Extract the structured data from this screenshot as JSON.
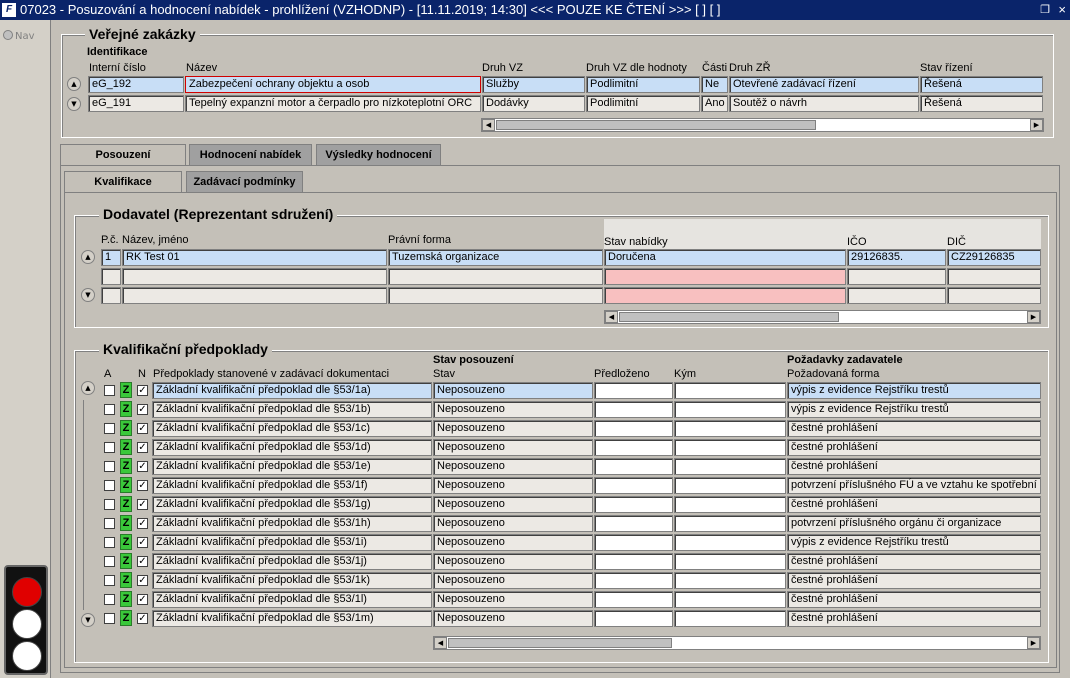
{
  "window": {
    "title": "07023 - Posuzování a hodnocení nabídek - prohlížení (VZHODNP) - [11.11.2019; 14:30] <<< POUZE KE ČTENÍ >>>  [ ]  [ ]",
    "icon": "app-logo-icon"
  },
  "nav": {
    "label": "Nav"
  },
  "zakazky": {
    "title": "Veřejné zakázky",
    "section": "Identifikace",
    "headers": {
      "interni": "Interní číslo",
      "nazev": "Název",
      "druh": "Druh VZ",
      "druh_hodnota": "Druh VZ dle hodnoty",
      "casti": "Části",
      "druh_zr": "Druh ZŘ",
      "stav": "Stav řízení"
    },
    "rows": [
      {
        "interni": "eG_192",
        "nazev": "Zabezpečení ochrany objektu a osob",
        "druh": "Služby",
        "druh_hodnota": "Podlimitní",
        "casti": "Ne",
        "druh_zr": "Otevřené zadávací řízení",
        "stav": "Řešená"
      },
      {
        "interni": "eG_191",
        "nazev": "Tepelný expanzní motor a čerpadlo pro nízkoteplotní ORC",
        "druh": "Dodávky",
        "druh_hodnota": "Podlimitní",
        "casti": "Ano",
        "druh_zr": "Soutěž o návrh",
        "stav": "Řešená"
      }
    ]
  },
  "tabs": {
    "main": [
      "Posouzení",
      "Hodnocení nabídek",
      "Výsledky hodnocení"
    ],
    "sub": [
      "Kvalifikace",
      "Zadávací podmínky"
    ]
  },
  "dodavatel": {
    "title": "Dodavatel (Reprezentant sdružení)",
    "headers": {
      "pc": "P.č.",
      "nazev": "Název, jméno",
      "forma": "Právní forma",
      "stav": "Stav nabídky",
      "ico": "IČO",
      "dic": "DIČ"
    },
    "rows": [
      {
        "pc": "1",
        "nazev": "RK Test 01",
        "forma": "Tuzemská organizace",
        "stav": "Doručena",
        "ico": "29126835.",
        "dic": "CZ29126835"
      }
    ]
  },
  "kvalifikace": {
    "title": "Kvalifikační předpoklady",
    "headers": {
      "a": "A",
      "n": "N",
      "predpoklady": "Předpoklady stanovené v zadávací dokumentaci",
      "stav_group": "Stav posouzení",
      "stav": "Stav",
      "predlozeno": "Předloženo",
      "kym": "Kým",
      "pozadavky_group": "Požadavky zadavatele",
      "forma": "Požadovaná forma"
    },
    "z_label": "Z",
    "rows": [
      {
        "predpoklad": "Základní kvalifikační předpoklad dle §53/1a)",
        "stav": "Neposouzeno",
        "forma": "výpis z evidence Rejstříku trestů"
      },
      {
        "predpoklad": "Základní kvalifikační předpoklad dle §53/1b)",
        "stav": "Neposouzeno",
        "forma": "výpis z evidence Rejstříku trestů"
      },
      {
        "predpoklad": "Základní kvalifikační předpoklad dle §53/1c)",
        "stav": "Neposouzeno",
        "forma": "čestné prohlášení"
      },
      {
        "predpoklad": "Základní kvalifikační předpoklad dle §53/1d)",
        "stav": "Neposouzeno",
        "forma": "čestné prohlášení"
      },
      {
        "predpoklad": "Základní kvalifikační předpoklad dle §53/1e)",
        "stav": "Neposouzeno",
        "forma": "čestné prohlášení"
      },
      {
        "predpoklad": "Základní kvalifikační předpoklad dle §53/1f)",
        "stav": "Neposouzeno",
        "forma": "potvrzení příslušného FÚ a ve vztahu ke spotřební d"
      },
      {
        "predpoklad": "Základní kvalifikační předpoklad dle §53/1g)",
        "stav": "Neposouzeno",
        "forma": "čestné prohlášení"
      },
      {
        "predpoklad": "Základní kvalifikační předpoklad dle §53/1h)",
        "stav": "Neposouzeno",
        "forma": "potvrzení příslušného orgánu či organizace"
      },
      {
        "predpoklad": "Základní kvalifikační předpoklad dle §53/1i)",
        "stav": "Neposouzeno",
        "forma": "výpis z evidence Rejstříku trestů"
      },
      {
        "predpoklad": "Základní kvalifikační předpoklad dle §53/1j)",
        "stav": "Neposouzeno",
        "forma": "čestné prohlášení"
      },
      {
        "predpoklad": "Základní kvalifikační předpoklad dle §53/1k)",
        "stav": "Neposouzeno",
        "forma": "čestné prohlášení"
      },
      {
        "predpoklad": "Základní kvalifikační předpoklad dle §53/1l)",
        "stav": "Neposouzeno",
        "forma": "čestné prohlášení"
      },
      {
        "predpoklad": "Základní kvalifikační předpoklad dle §53/1m)",
        "stav": "Neposouzeno",
        "forma": "čestné prohlášení"
      }
    ]
  },
  "traffic_light": {
    "active": "red",
    "colors": {
      "red": "#e00000",
      "off": "#ffffff"
    }
  }
}
